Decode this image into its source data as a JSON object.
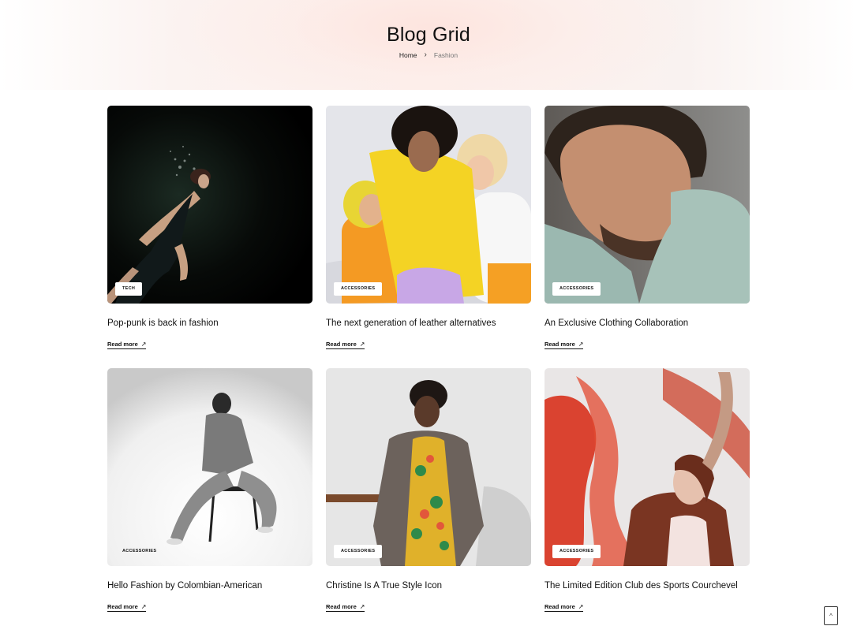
{
  "hero": {
    "title": "Blog Grid",
    "breadcrumb": {
      "home": "Home",
      "separator": "›",
      "current": "Fashion"
    }
  },
  "posts": [
    {
      "title": "Pop-punk is back in fashion",
      "tag": "TECH",
      "read_more": "Read more",
      "image": "diver-in-dark-water"
    },
    {
      "title": "The next generation of leather alternatives",
      "tag": "ACCESSORIES",
      "read_more": "Read more",
      "image": "three-kids-colorful"
    },
    {
      "title": "An Exclusive Clothing Collaboration",
      "tag": "ACCESSORIES",
      "read_more": "Read more",
      "image": "man-portrait-closeup"
    },
    {
      "title": "Hello Fashion by Colombian-American",
      "tag": "ACCESSORIES",
      "read_more": "Read more",
      "image": "woman-on-chair-bw"
    },
    {
      "title": "Christine Is A True Style Icon",
      "tag": "ACCESSORIES",
      "read_more": "Read more",
      "image": "woman-floral-jumpsuit"
    },
    {
      "title": "The Limited Edition Club des Sports Courchevel",
      "tag": "ACCESSORIES",
      "read_more": "Read more",
      "image": "woman-red-fabric"
    }
  ],
  "icons": {
    "read_more_arrow": "↗",
    "scroll_top": "^"
  }
}
